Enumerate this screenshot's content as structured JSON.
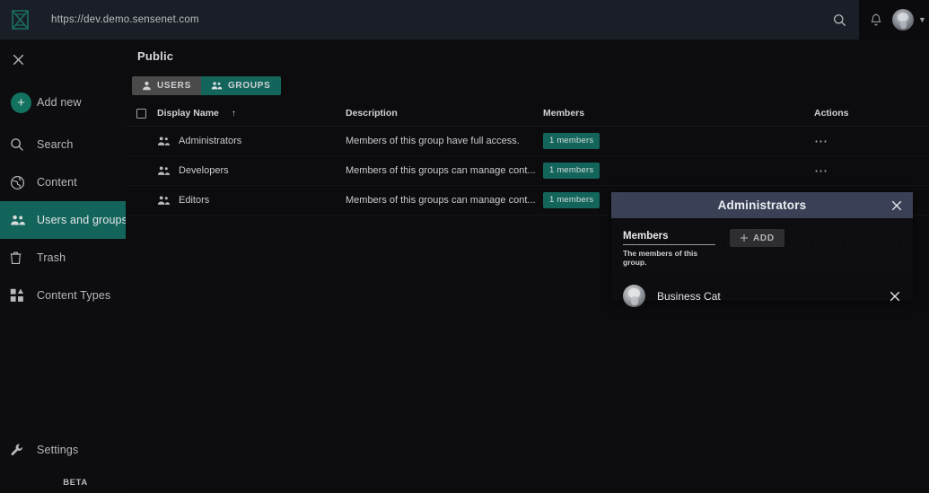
{
  "topbar": {
    "url": "https://dev.demo.sensenet.com",
    "logo_icon": "sensenet-logo-icon",
    "search_icon": "search-icon",
    "bell_icon": "notifications-bell-icon",
    "avatar_icon": "user-avatar",
    "chevron_icon": "chevron-down-icon"
  },
  "sidebar": {
    "close_icon": "close-icon",
    "items": [
      {
        "label": "Add new",
        "icon": "plus-circle-icon",
        "active": false
      },
      {
        "label": "Search",
        "icon": "search-icon",
        "active": false
      },
      {
        "label": "Content",
        "icon": "globe-icon",
        "active": false
      },
      {
        "label": "Users and groups",
        "icon": "people-group-icon",
        "active": true
      },
      {
        "label": "Trash",
        "icon": "trash-icon",
        "active": false
      },
      {
        "label": "Content Types",
        "icon": "content-types-icon",
        "active": false
      }
    ],
    "settings": {
      "label": "Settings",
      "icon": "wrench-icon"
    },
    "beta": "BETA"
  },
  "main": {
    "title": "Public",
    "tabs": [
      {
        "label": "USERS",
        "icon": "user-icon",
        "active": false
      },
      {
        "label": "GROUPS",
        "icon": "people-group-icon",
        "active": true
      }
    ],
    "table": {
      "headers": {
        "display_name": "Display Name",
        "sort_arrow": "↑",
        "description": "Description",
        "members": "Members",
        "actions": "Actions"
      },
      "rows": [
        {
          "name": "Administrators",
          "description": "Members of this group have full access.",
          "members_badge": "1 members",
          "actions_icon": "more-horizontal-icon",
          "has_actions": true
        },
        {
          "name": "Developers",
          "description": "Members of this groups can manage cont...",
          "members_badge": "1 members",
          "actions_icon": "more-horizontal-icon",
          "has_actions": true
        },
        {
          "name": "Editors",
          "description": "Members of this groups can manage cont...",
          "members_badge": "1 members",
          "actions_icon": "more-horizontal-icon",
          "has_actions": false
        }
      ]
    }
  },
  "dialog": {
    "title": "Administrators",
    "close_icon": "close-icon",
    "members_label": "Members",
    "members_help": "The members of this group.",
    "add_button": "ADD",
    "add_icon": "plus-icon",
    "member": {
      "name": "Business Cat",
      "avatar_icon": "member-avatar",
      "remove_icon": "close-icon"
    }
  },
  "colors": {
    "accent_teal": "#13655c",
    "tab_inactive": "#4a4a4a",
    "dialog_header": "#3a4055",
    "page_bg": "#0c0c0e",
    "topbar_bg": "#1a1f27"
  }
}
